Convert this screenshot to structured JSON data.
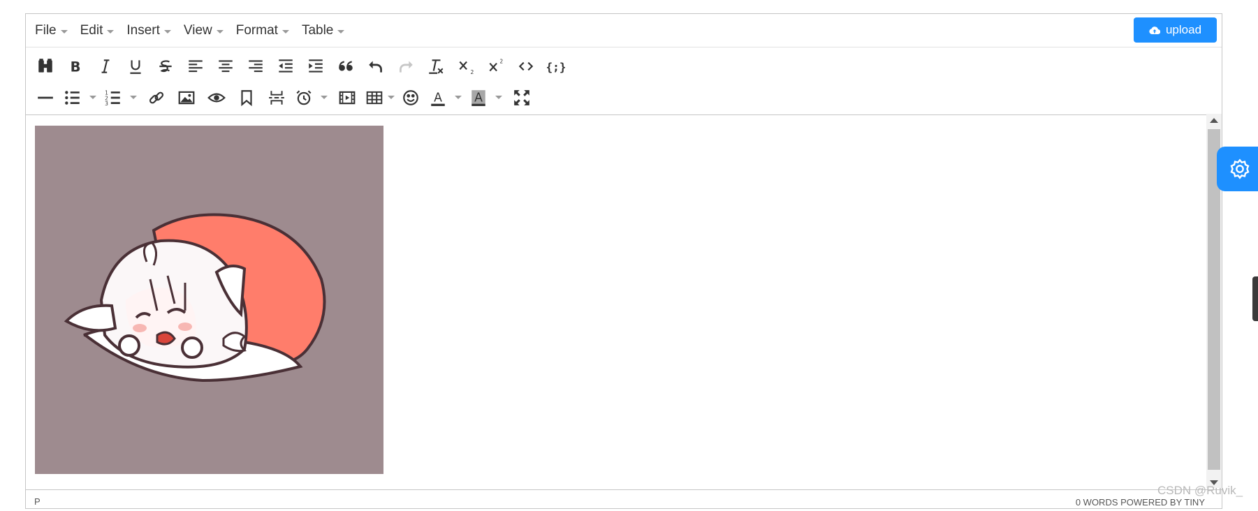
{
  "menubar": {
    "items": [
      {
        "label": "File"
      },
      {
        "label": "Edit"
      },
      {
        "label": "Insert"
      },
      {
        "label": "View"
      },
      {
        "label": "Format"
      },
      {
        "label": "Table"
      }
    ],
    "upload": {
      "label": "upload",
      "icon": "cloud-upload-icon"
    }
  },
  "toolbar": {
    "row1": [
      "find-replace-icon",
      "bold-icon",
      "italic-icon",
      "underline-icon",
      "strikethrough-icon",
      "align-left-icon",
      "align-center-icon",
      "align-right-icon",
      "outdent-icon",
      "indent-icon",
      "blockquote-icon",
      "undo-icon",
      "redo-icon",
      "remove-format-icon",
      "subscript-icon",
      "superscript-icon",
      "source-code-icon",
      "code-sample-icon"
    ],
    "row2": [
      "horizontal-rule-icon",
      "bullet-list-icon",
      "numbered-list-icon",
      "link-icon",
      "image-icon",
      "preview-icon",
      "anchor-icon",
      "page-break-icon",
      "insert-datetime-icon",
      "media-icon",
      "table-icon",
      "emoticons-icon",
      "text-color-icon",
      "background-color-icon",
      "fullscreen-icon"
    ]
  },
  "content": {
    "image_colors": {
      "background": "#9e8b8f",
      "blanket": "#ff7d6b",
      "outline": "#4a3036"
    }
  },
  "statusbar": {
    "path": "P",
    "words": "0 WORDS POWERED BY TINY"
  },
  "watermark": "CSDN @Ruvik_",
  "colors": {
    "accent": "#1e90ff"
  }
}
